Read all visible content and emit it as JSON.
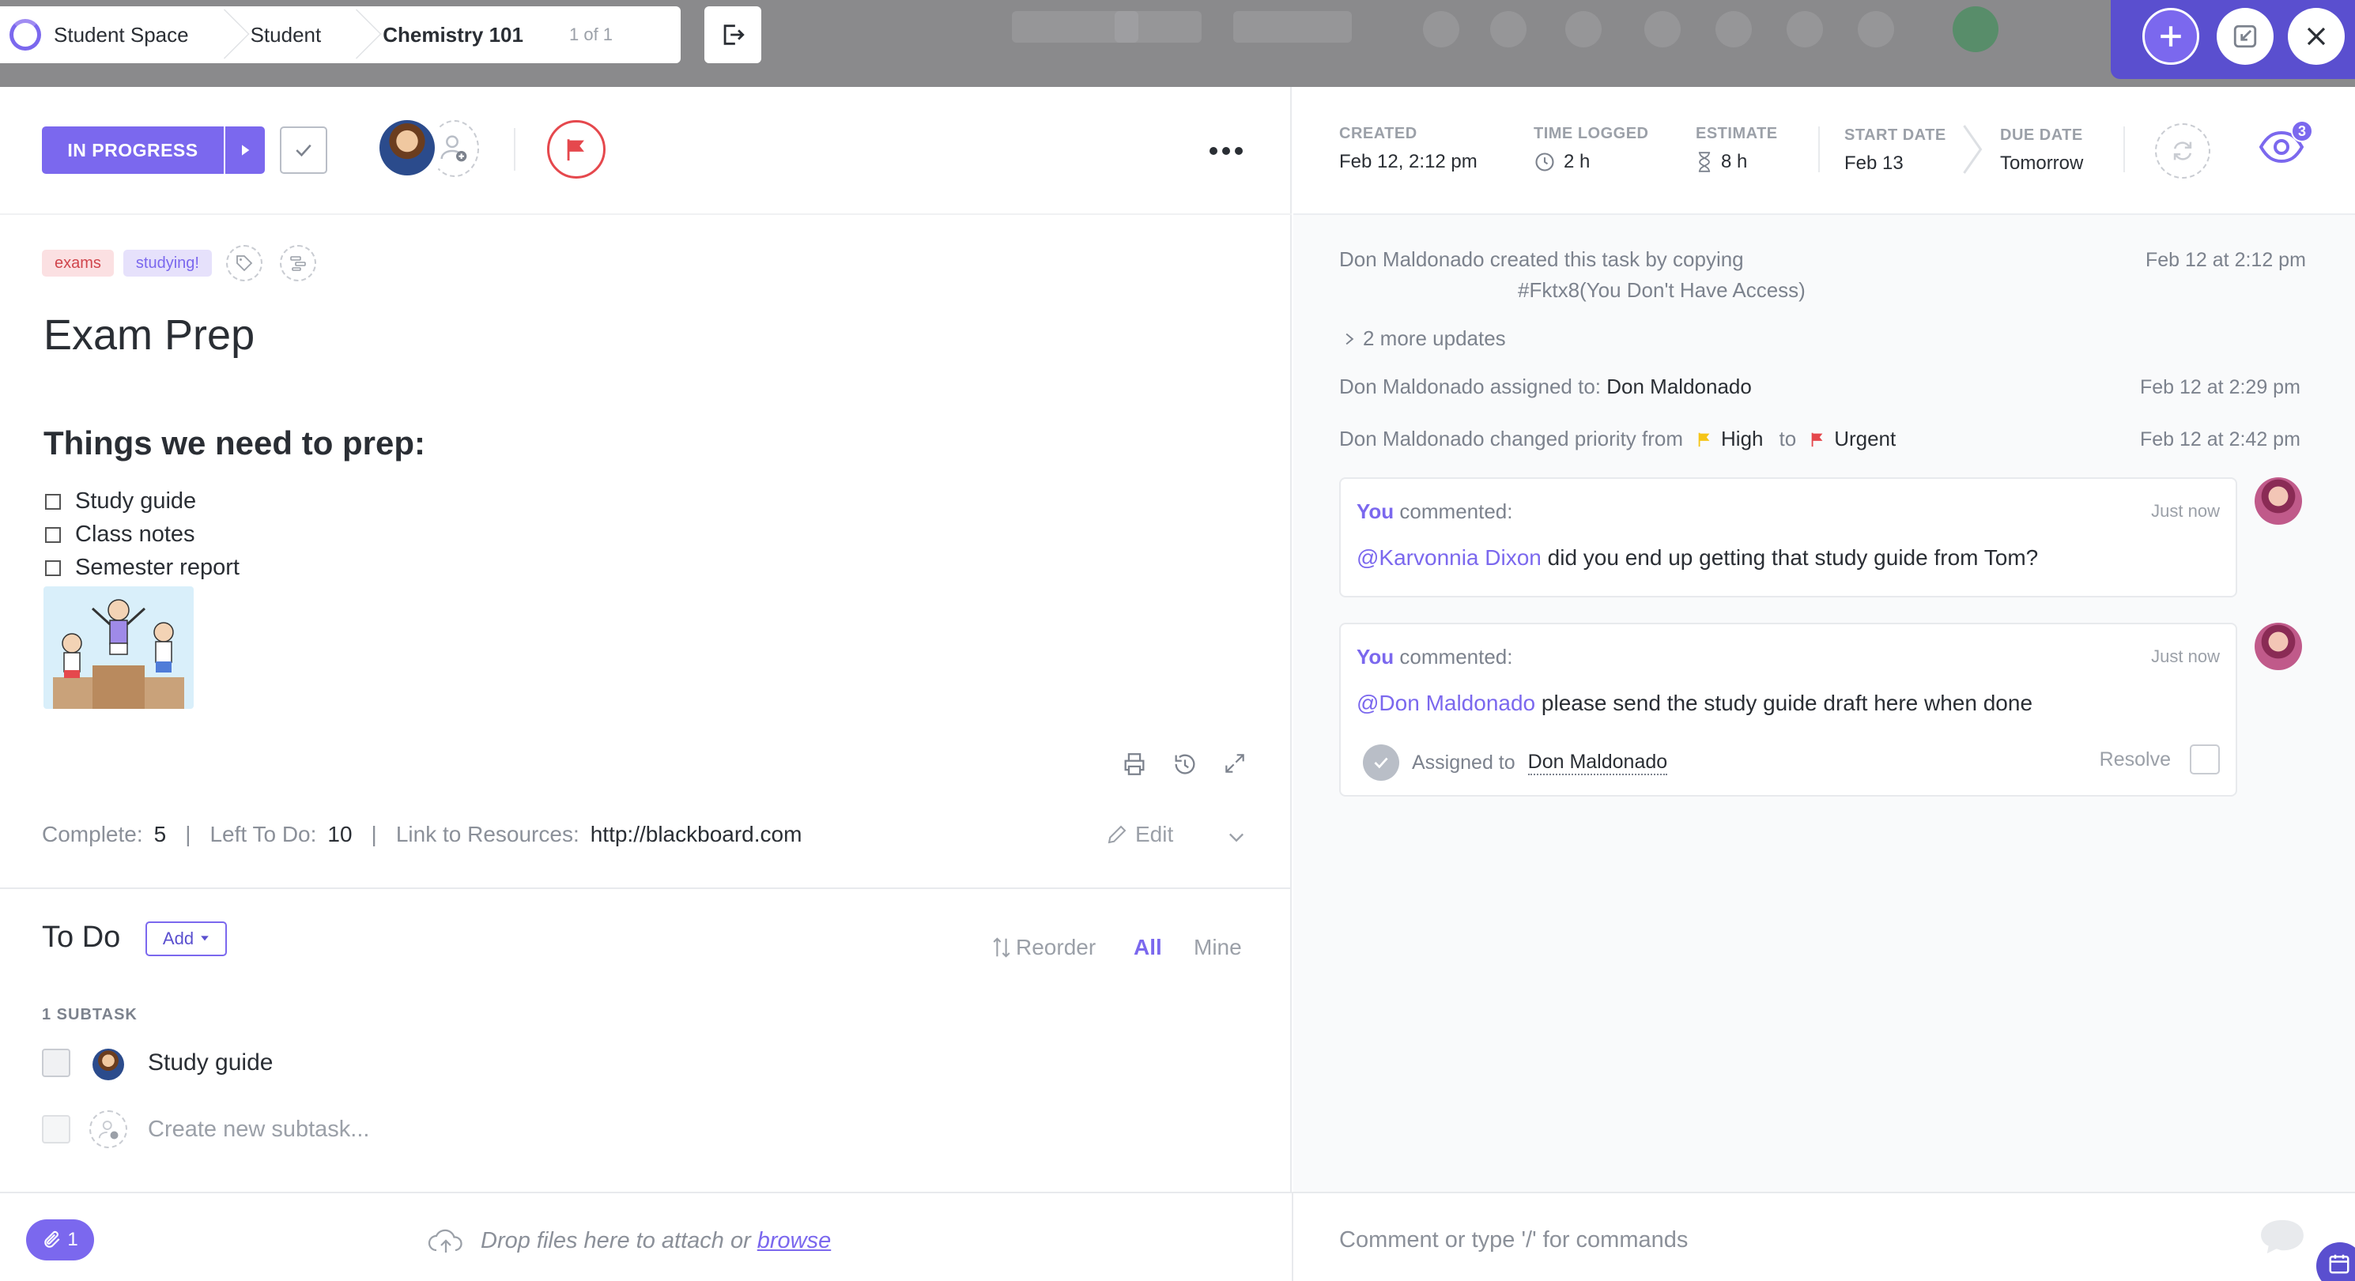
{
  "breadcrumb": {
    "space": "Student Space",
    "folder": "Student",
    "list": "Chemistry 101",
    "position": "1 of 1"
  },
  "toolbar": {
    "status_label": "IN PROGRESS",
    "watchers_count": "3"
  },
  "stats": {
    "created_label": "CREATED",
    "created_value": "Feb 12, 2:12 pm",
    "time_logged_label": "TIME LOGGED",
    "time_logged_value": "2 h",
    "estimate_label": "ESTIMATE",
    "estimate_value": "8 h",
    "start_label": "START DATE",
    "start_value": "Feb 13",
    "due_label": "DUE DATE",
    "due_value": "Tomorrow"
  },
  "task": {
    "tags": [
      "exams",
      "studying!"
    ],
    "title": "Exam Prep",
    "heading": "Things we need to prep:",
    "checklist": [
      "Study guide",
      "Class notes",
      "Semester report"
    ],
    "complete_label": "Complete:",
    "complete_value": "5",
    "left_label": "Left To Do:",
    "left_value": "10",
    "link_label": "Link to Resources:",
    "link_value": "http://blackboard.com",
    "edit_label": "Edit"
  },
  "todo": {
    "title": "To Do",
    "add_label": "Add",
    "reorder_label": "Reorder",
    "filter_all": "All",
    "filter_mine": "Mine",
    "subtask_header": "1 SUBTASK",
    "subtask_name": "Study guide",
    "new_subtask_placeholder": "Create new subtask..."
  },
  "activity": {
    "a1_text": "Don Maldonado created this task by copying",
    "a1_ref": "#Fktx8(You Don't Have Access)",
    "a1_time": "Feb 12 at 2:12 pm",
    "more_updates": "2 more updates",
    "a2_actor": "Don Maldonado assigned to:",
    "a2_target": "Don Maldonado",
    "a2_time": "Feb 12 at 2:29 pm",
    "a3_actor": "Don Maldonado changed priority from",
    "a3_from": "High",
    "a3_to_word": "to",
    "a3_to": "Urgent",
    "a3_time": "Feb 12 at 2:42 pm"
  },
  "comments": [
    {
      "author": "You",
      "verb": "commented:",
      "time": "Just now",
      "mention": "@Karvonnia Dixon",
      "text": "did you end up getting that study guide from Tom?"
    },
    {
      "author": "You",
      "verb": "commented:",
      "time": "Just now",
      "mention": "@Don Maldonado",
      "text": "please send the study guide draft here when done",
      "assigned_label": "Assigned to",
      "assigned_name": "Don Maldonado",
      "resolve_label": "Resolve"
    }
  ],
  "bottom": {
    "attachment_count": "1",
    "drop_text": "Drop files here to attach or",
    "browse_link": "browse",
    "comment_placeholder": "Comment or type '/' for commands"
  },
  "colors": {
    "accent": "#7b68ee",
    "urgent": "#e5484d",
    "high": "#f5c518"
  }
}
